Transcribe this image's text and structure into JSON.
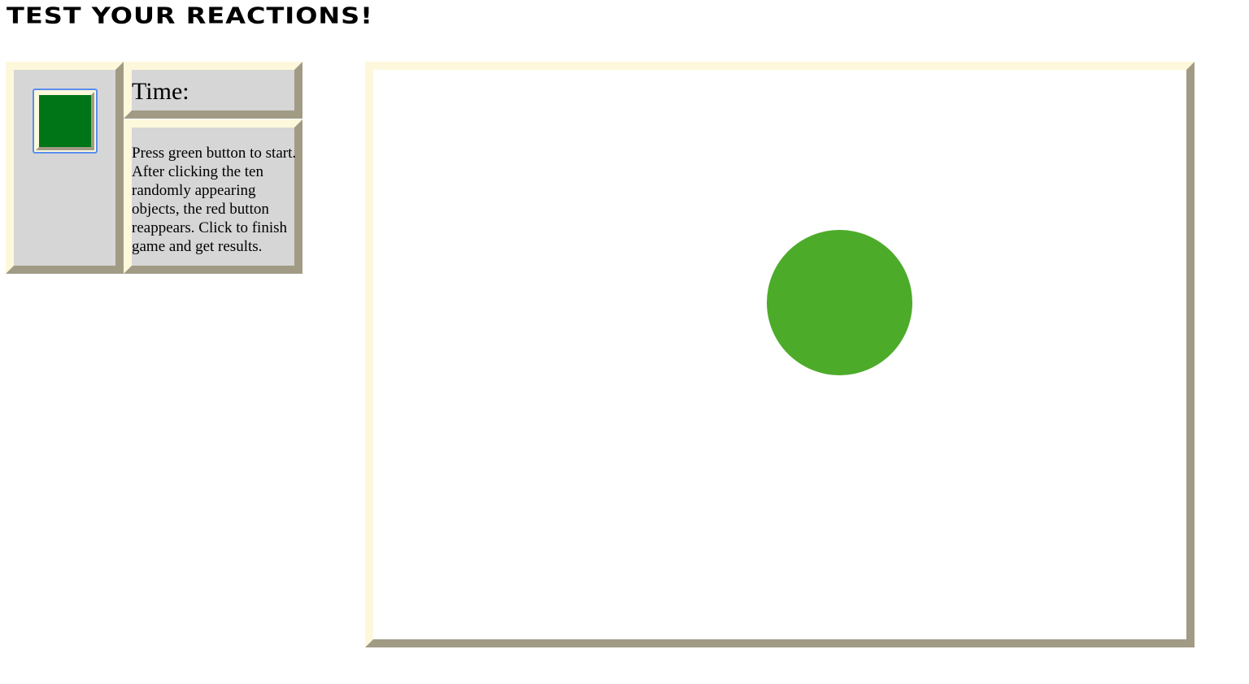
{
  "page": {
    "title": "TEST YOUR REACTIONS!"
  },
  "controls": {
    "start_button_color": "#007517",
    "time_label": "Time:",
    "instructions": "Press green button to start. After clicking the ten randomly appearing objects, the red button reappears. Click to finish game and get results."
  },
  "game": {
    "target_shape": "circle",
    "target_color": "#4dab2a"
  },
  "colors": {
    "bevel_light": "#fdf8dc",
    "bevel_dark": "#a19b86",
    "panel_background": "#d6d6d6",
    "focus_ring": "#5b8def"
  }
}
